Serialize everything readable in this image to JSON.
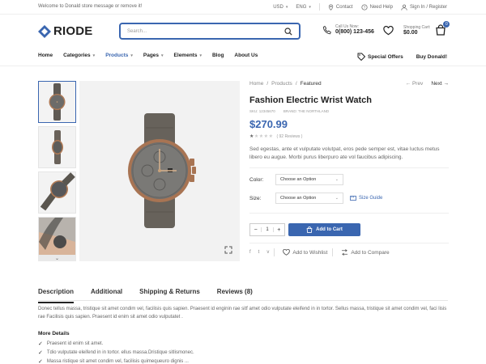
{
  "topbar": {
    "welcome": "Welcome to Donald store message or remove it!",
    "currency": "USD",
    "language": "ENG",
    "contact": "Contact",
    "need_help": "Need Help",
    "signin": "Sign In / Register"
  },
  "header": {
    "logo_text": "RIODE",
    "search_placeholder": "Search...",
    "call_label": "Call Us Now:",
    "phone": "0(800) 123-456",
    "cart_label": "Shopping Cart:",
    "cart_total": "$0.00",
    "cart_count": "0"
  },
  "nav": {
    "items": [
      {
        "label": "Home",
        "caret": false
      },
      {
        "label": "Categories",
        "caret": true
      },
      {
        "label": "Products",
        "caret": true
      },
      {
        "label": "Pages",
        "caret": true
      },
      {
        "label": "Elements",
        "caret": true
      },
      {
        "label": "Blog",
        "caret": false
      },
      {
        "label": "About Us",
        "caret": false
      }
    ],
    "special_offers": "Special Offers",
    "buy": "Buy Donald!"
  },
  "breadcrumb": {
    "home": "Home",
    "products": "Products",
    "current": "Featured",
    "prev": "Prev",
    "next": "Next"
  },
  "product": {
    "title": "Fashion Electric Wrist Watch",
    "sku_label": "SKU:",
    "sku": "12345670",
    "brand_label": "BRAND:",
    "brand": "THE NORTHLAND",
    "price": "$270.99",
    "rating": 1,
    "rating_max": 5,
    "reviews": "( 92 Reviews )",
    "description": "Sed egestas, ante et vulputate volutpat, eros pede semper est, vitae luctus metus libero eu augue. Morbi purus liberpuro ate vol faucibus adipiscing.",
    "color_label": "Color:",
    "color_value": "Choose an Option",
    "size_label": "Size:",
    "size_value": "Choose an Option",
    "size_guide": "Size Guide",
    "qty": "1",
    "qty_minus": "−",
    "qty_plus": "+",
    "add_to_cart": "Add to Cart",
    "wishlist": "Add to Wishlist",
    "compare": "Add to Compare"
  },
  "tabs": {
    "items": [
      "Description",
      "Additional",
      "Shipping & Returns",
      "Reviews (8)"
    ],
    "body": "Donec tellus massa, tristique sit amet condim vel, facilisis quis sapien. Praesent id enginin rae sitf amet odio vulputate eleifend in in tortor. Sellus massa, tristique sit amet condim vel, faci lisis rae Facilisis quis sapien. Praesent id enim sit amet odio vulputatet .",
    "more_details": "More Details",
    "details": [
      "Praesent id enim sit amet.",
      "Tdio vulputate eleifend in in tortor. ellus massa.Dristique sitlismonec.",
      "Massa ristique sit amet condim vel, facilisis quimequeuro dignis ..."
    ]
  },
  "colors": {
    "accent": "#3a66b0",
    "text": "#333333"
  }
}
